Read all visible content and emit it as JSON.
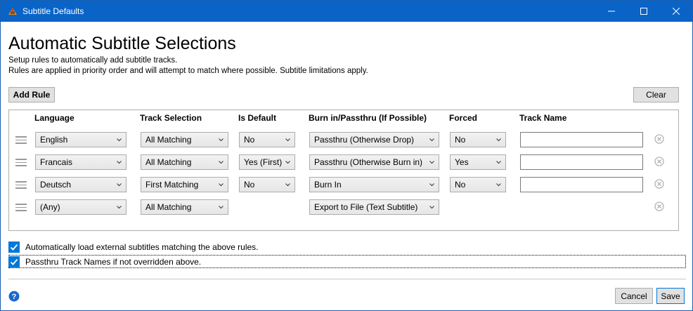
{
  "window": {
    "title": "Subtitle Defaults"
  },
  "page": {
    "heading": "Automatic Subtitle Selections",
    "desc1": "Setup rules to automatically add subtitle tracks.",
    "desc2": "Rules are applied in priority order and will attempt to match where possible. Subtitle limitations apply."
  },
  "toolbar": {
    "add_rule": "Add Rule",
    "clear": "Clear"
  },
  "table": {
    "columns": [
      "Language",
      "Track Selection",
      "Is Default",
      "Burn in/Passthru (If Possible)",
      "Forced",
      "Track Name"
    ],
    "rows": [
      {
        "language": "English",
        "track": "All Matching",
        "default": "No",
        "burn": "Passthru (Otherwise Drop)",
        "forced": "No",
        "name": ""
      },
      {
        "language": "Francais",
        "track": "All Matching",
        "default": "Yes (First)",
        "burn": "Passthru (Otherwise Burn in)",
        "forced": "Yes",
        "name": ""
      },
      {
        "language": "Deutsch",
        "track": "First Matching",
        "default": "No",
        "burn": "Burn In",
        "forced": "No",
        "name": ""
      },
      {
        "language": "(Any)",
        "track": "All Matching",
        "burn": "Export to File (Text Subtitle)"
      }
    ]
  },
  "options": {
    "auto_load": {
      "label": "Automatically load external subtitles matching the above rules.",
      "checked": true
    },
    "passthru_names": {
      "label": "Passthru Track Names if not overridden above.",
      "checked": true
    }
  },
  "footer": {
    "cancel": "Cancel",
    "save": "Save"
  },
  "colors": {
    "titlebar": "#0a64c8",
    "accent": "#0078d7",
    "remove_icon": "#b4b4b4"
  }
}
